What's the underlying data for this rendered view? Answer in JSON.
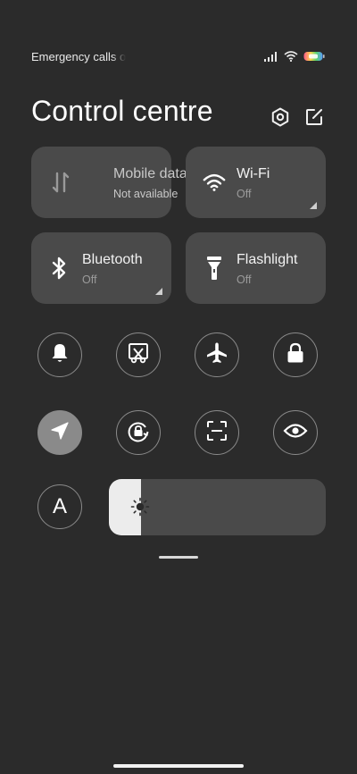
{
  "status_bar": {
    "carrier": "Emergency calls only",
    "icons": [
      "signal-icon",
      "wifi-icon",
      "battery-icon"
    ]
  },
  "header": {
    "title": "Control centre",
    "icons": [
      "settings-icon",
      "edit-icon"
    ]
  },
  "tiles": [
    {
      "label": "Mobile data",
      "sub": "Not available",
      "icon": "mobile-data-icon"
    },
    {
      "label": "Wi-Fi",
      "sub": "Off",
      "icon": "wifi-icon"
    },
    {
      "label": "Bluetooth",
      "sub": "Off",
      "icon": "bluetooth-icon"
    },
    {
      "label": "Flashlight",
      "sub": "Off",
      "icon": "flashlight-icon"
    }
  ],
  "toggles_row1": [
    "bell-icon",
    "screenshot-icon",
    "airplane-icon",
    "lock-icon"
  ],
  "toggles_row2": [
    "location-icon",
    "rotation-lock-icon",
    "scanner-icon",
    "eye-icon"
  ],
  "auto_brightness": {
    "letter": "A"
  },
  "brightness": {
    "level": 0.15,
    "icon": "sun-icon"
  },
  "colors": {
    "background": "#2b2b2b",
    "tile": "#4a4a4a",
    "active_toggle": "#8a8a8a",
    "brightness_fill": "#ececec"
  }
}
